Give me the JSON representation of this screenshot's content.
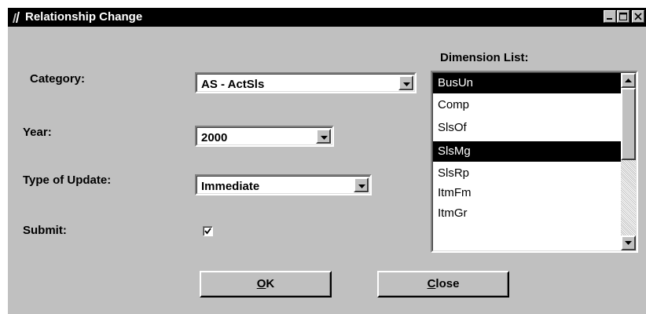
{
  "window": {
    "title": "Relationship Change",
    "controls": {
      "minimize": "minimize",
      "maximize": "maximize",
      "close": "close"
    }
  },
  "form": {
    "category": {
      "label": "Category:",
      "value": "AS -  ActSls"
    },
    "year": {
      "label": "Year:",
      "value": "2000"
    },
    "update_type": {
      "label": "Type of Update:",
      "value": "Immediate"
    },
    "submit": {
      "label": "Submit:",
      "checked": true
    }
  },
  "dimension_list": {
    "label": "Dimension List:",
    "items": [
      {
        "label": "BusUn",
        "selected": true
      },
      {
        "label": "Comp",
        "selected": false
      },
      {
        "label": "SlsOf",
        "selected": false
      },
      {
        "label": "SlsMg",
        "selected": true
      },
      {
        "label": "SlsRp",
        "selected": false
      },
      {
        "label": "ItmFm",
        "selected": false
      },
      {
        "label": "ItmGr",
        "selected": false
      }
    ]
  },
  "buttons": {
    "ok": {
      "mnemonic": "O",
      "rest": "K"
    },
    "close": {
      "mnemonic": "C",
      "rest": "lose"
    }
  },
  "colors": {
    "window_bg": "#c0c0c0",
    "titlebar_bg": "#000000",
    "selection_bg": "#000000"
  }
}
